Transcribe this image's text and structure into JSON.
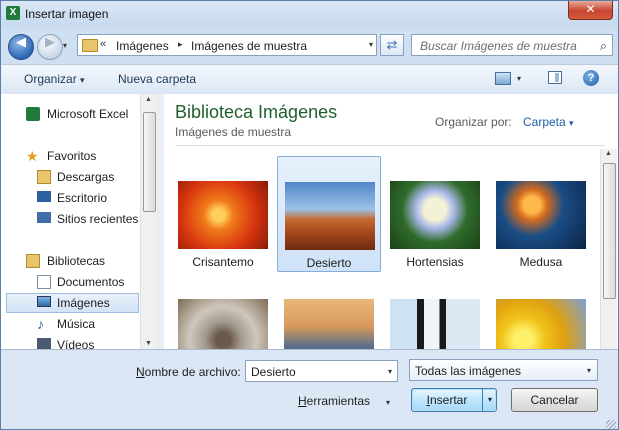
{
  "window": {
    "title": "Insertar imagen",
    "app_icon": "X",
    "close_symbol": "✕"
  },
  "address": {
    "back_symbol": "◀",
    "forward_symbol": "▶",
    "history_symbol": "▾",
    "overflow": "«",
    "crumbs": [
      "Imágenes",
      "Imágenes de muestra"
    ],
    "crumb_sep": "▸",
    "dropdown_symbol": "▾",
    "refresh_symbol": "⇄"
  },
  "search": {
    "placeholder": "Buscar Imágenes de muestra",
    "icon_symbol": "⌕"
  },
  "toolbar": {
    "organize_label": "Organizar",
    "organize_arrow": "▾",
    "new_folder_label": "Nueva carpeta",
    "view_arrow": "▾",
    "help_symbol": "?"
  },
  "nav": {
    "items": [
      {
        "label": "Microsoft Excel"
      },
      {
        "label": "Favoritos"
      },
      {
        "label": "Descargas"
      },
      {
        "label": "Escritorio"
      },
      {
        "label": "Sitios recientes"
      },
      {
        "label": "Bibliotecas"
      },
      {
        "label": "Documentos"
      },
      {
        "label": "Imágenes",
        "selected": true
      },
      {
        "label": "Música"
      },
      {
        "label": "Vídeos"
      }
    ],
    "scroll_up": "▲",
    "scroll_down": "▼"
  },
  "library": {
    "title": "Biblioteca Imágenes",
    "subtitle": "Imágenes de muestra",
    "arrange_label": "Organizar por:",
    "arrange_value": "Carpeta",
    "arrange_arrow": "▾"
  },
  "files": [
    {
      "label": "Crisantemo"
    },
    {
      "label": "Desierto",
      "selected": true
    },
    {
      "label": "Hortensias"
    },
    {
      "label": "Medusa"
    },
    {
      "label": ""
    },
    {
      "label": ""
    },
    {
      "label": ""
    },
    {
      "label": ""
    }
  ],
  "footer": {
    "filename_label_key": "N",
    "filename_label_rest": "ombre de archivo:",
    "filename_value": "Desierto",
    "filename_arrow": "▾",
    "filter_value": "Todas las imágenes",
    "filter_arrow": "▾",
    "tools_label_key": "H",
    "tools_label_rest": "erramientas",
    "tools_arrow": "▾",
    "insert_label_key": "I",
    "insert_label_rest": "nsertar",
    "insert_arrow": "▾",
    "cancel_label": "Cancelar"
  },
  "colors": {
    "title_green": "#1e5f2d",
    "link_blue": "#1e5fa8",
    "selection": "#cfe2f7"
  }
}
